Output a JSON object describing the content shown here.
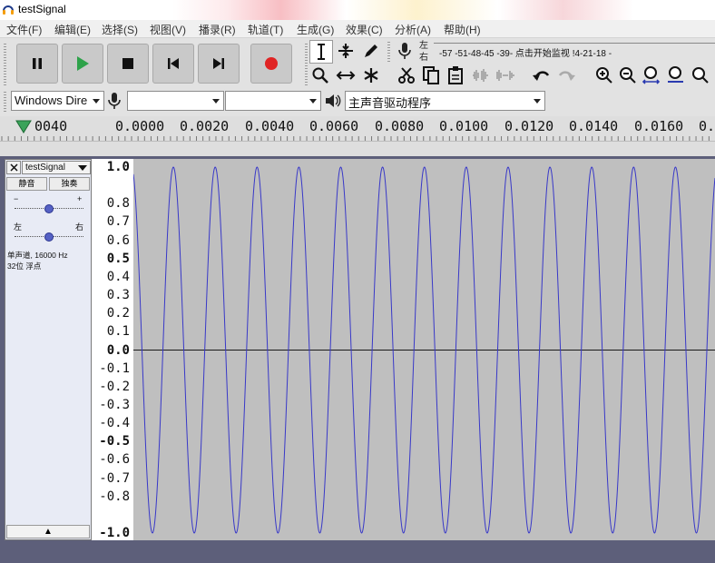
{
  "window": {
    "title": "testSignal"
  },
  "menu": [
    "文件(F)",
    "编辑(E)",
    "选择(S)",
    "视图(V)",
    "播录(R)",
    "轨道(T)",
    "生成(G)",
    "效果(C)",
    "分析(A)",
    "帮助(H)"
  ],
  "meter": {
    "channel_left": "左",
    "channel_right": "右",
    "scale_text": "-57   -51-48-45   -39-  点击开始监视  !4-21-18   -"
  },
  "devices": {
    "host": "Windows Dire",
    "input": "",
    "channels": "",
    "output": "主声音驱动程序"
  },
  "timeline": {
    "labels": [
      "0040",
      "0.0000",
      "0.0020",
      "0.0040",
      "0.0060",
      "0.0080",
      "0.0100",
      "0.0120",
      "0.0140",
      "0.0160",
      "0."
    ]
  },
  "track": {
    "name": "testSignal",
    "mute_label": "静音",
    "solo_label": "独奏",
    "gain_minus": "−",
    "gain_plus": "+",
    "pan_left": "左",
    "pan_right": "右",
    "info_line1": "单声道, 16000 Hz",
    "info_line2": "32位 浮点",
    "collapse_glyph": "▲"
  },
  "amplitude_ruler": [
    "1.0",
    "0.8",
    "0.7",
    "0.6",
    "0.5",
    "0.4",
    "0.3",
    "0.2",
    "0.1",
    "0.0",
    "-0.1",
    "-0.2",
    "-0.3",
    "-0.4",
    "-0.5",
    "-0.6",
    "-0.7",
    "-0.8",
    "-1.0"
  ],
  "waveform": {
    "color": "#3838c8",
    "background": "#bfbfbf",
    "cycles_visible": 13.9,
    "amplitude": 1.0
  },
  "colors": {
    "play": "#2ea24a",
    "record": "#e02424",
    "cursor_triangle": "#3aa35a"
  }
}
